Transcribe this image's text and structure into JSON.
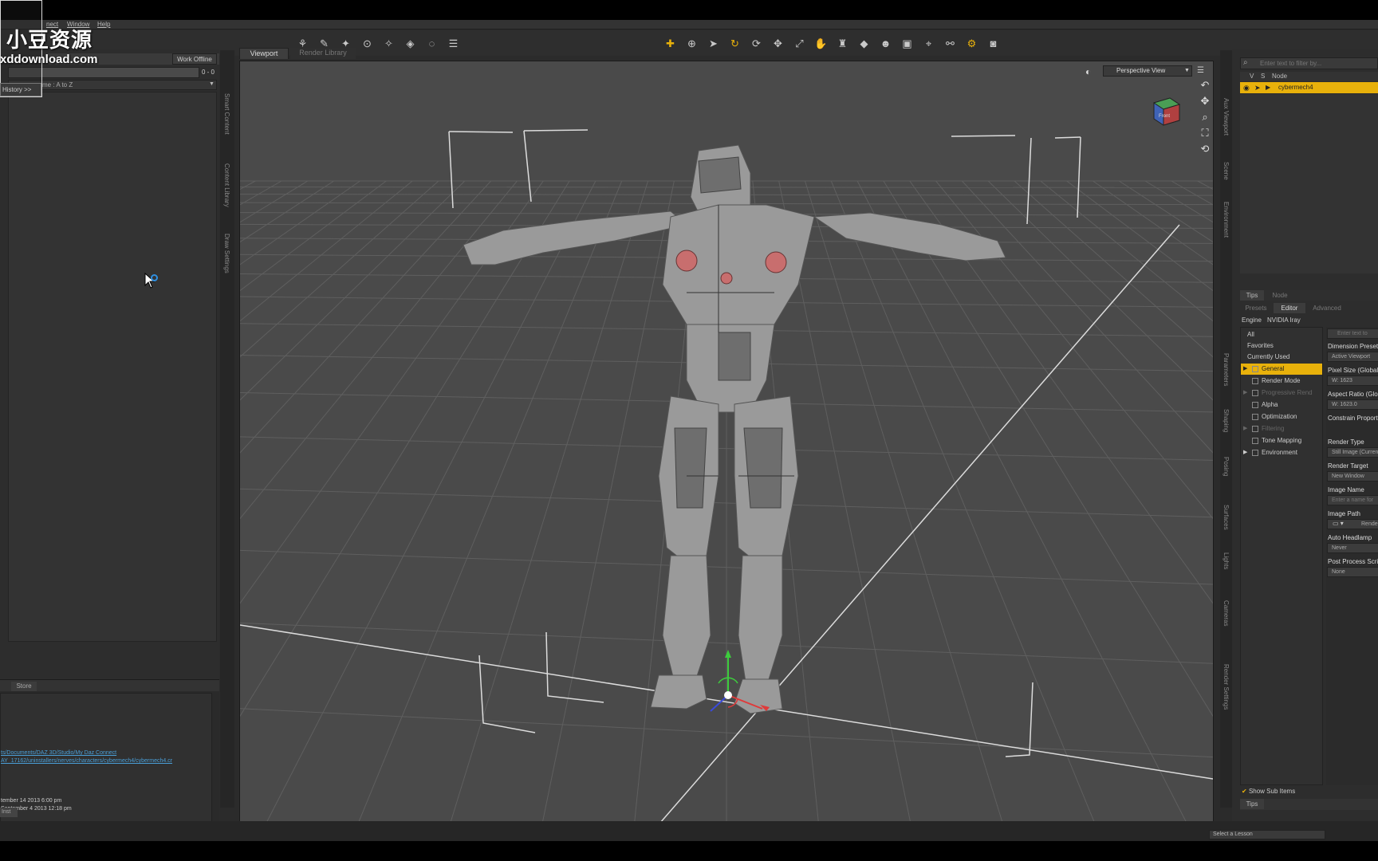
{
  "menu": {
    "items": [
      "nect",
      "Window",
      "Help"
    ]
  },
  "watermark": {
    "cn": "小豆资源",
    "url": "xddownload.com",
    "history": "History >>"
  },
  "left_panel": {
    "work_offline": "Work Offline",
    "count": "0 - 0",
    "sort_label": "me : A to Z",
    "side_tabs": [
      "Smart Content",
      "Content Library",
      "Draw Settings"
    ],
    "bottom_tab": "Store",
    "info_link1": "ts/Documents/DAZ 3D/Studio/My Daz Connect",
    "info_link2": "AY_17162/uninstallers/nerves/characters/cybermech4/cybermech4.cr",
    "info_date1": "tember 14 2013 6:00 pm",
    "info_date2": "September 4 2013 12:18 pm",
    "foot": "Inst"
  },
  "viewport": {
    "tabs": [
      "Viewport",
      "Render Library"
    ],
    "perspective": "Perspective View",
    "navcube_label": "Front"
  },
  "right_panel": {
    "scene_search_placeholder": "Enter text to filter by...",
    "scene_cols": [
      "V",
      "S",
      "Node"
    ],
    "scene_node": "cybermech4",
    "tips_tabs": [
      "Tips",
      "Node"
    ],
    "render_tabs": [
      "Presets",
      "Editor",
      "Advanced"
    ],
    "engine_label": "Engine",
    "engine_value": "NVIDIA Iray",
    "side_tabs": [
      "Aux Viewport",
      "Scene",
      "Environment",
      "Parameters",
      "Shaping",
      "Posing",
      "Surfaces",
      "Lights",
      "Cameras",
      "Render Settings"
    ],
    "categories": [
      {
        "label": "All",
        "type": "plain"
      },
      {
        "label": "Favorites",
        "type": "plain"
      },
      {
        "label": "Currently Used",
        "type": "plain"
      },
      {
        "label": "General",
        "type": "selected"
      },
      {
        "label": "Render Mode",
        "type": "item"
      },
      {
        "label": "Progressive Rend",
        "type": "dim"
      },
      {
        "label": "Alpha",
        "type": "item"
      },
      {
        "label": "Optimization",
        "type": "item"
      },
      {
        "label": "Filtering",
        "type": "dim"
      },
      {
        "label": "Tone Mapping",
        "type": "item"
      },
      {
        "label": "Environment",
        "type": "item"
      }
    ],
    "props_search": "Enter text to",
    "properties": [
      {
        "label": "Dimension Preset (",
        "value": "Active Viewport"
      },
      {
        "label": "Pixel Size (Global)",
        "value": "W: 1623"
      },
      {
        "label": "Aspect Ratio (Glob",
        "value": "W: 1623.0"
      },
      {
        "label": "Constrain Proportio",
        "value": ""
      },
      {
        "label": "Render Type",
        "value": "Still Image (Curren"
      },
      {
        "label": "Render Target",
        "value": "New Window"
      },
      {
        "label": "Image Name",
        "value": "Enter a name for"
      },
      {
        "label": "Image Path",
        "value": "Render"
      },
      {
        "label": "Auto Headlamp",
        "value": "Never"
      },
      {
        "label": "Post Process Scrip",
        "value": "None"
      }
    ],
    "show_sub": "Show Sub Items",
    "tips_bottom": "Tips"
  },
  "status": {
    "lesson": "Select a Lesson"
  }
}
